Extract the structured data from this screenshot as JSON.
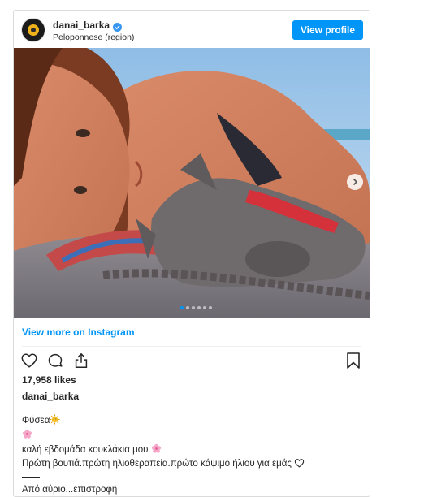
{
  "header": {
    "username": "danai_barka",
    "location": "Peloponnese (region)",
    "view_profile_label": "View profile"
  },
  "media": {
    "carousel_dots": 6,
    "active_dot": 1
  },
  "view_more_label": "View more on Instagram",
  "likes_label": "17,958 likes",
  "caption": {
    "username": "danai_barka",
    "line1": "Φύσεα",
    "line3": "καλή εβδομάδα κουκλάκια μου",
    "line4": "Πρώτη βουτιά.πρώτη ηλιοθεραπεία.πρώτο κάψιμο ήλιου για εμάς",
    "line6": "Από αύριο...επιστροφή"
  },
  "icons": {
    "like": "heart-outline-icon",
    "comment": "comment-bubble-icon",
    "share": "share-icon",
    "save": "bookmark-icon",
    "verified": "verified-badge-icon",
    "next": "chevron-right-icon"
  },
  "colors": {
    "accent": "#0095f6",
    "text": "#262626",
    "border": "#dbdbdb"
  }
}
